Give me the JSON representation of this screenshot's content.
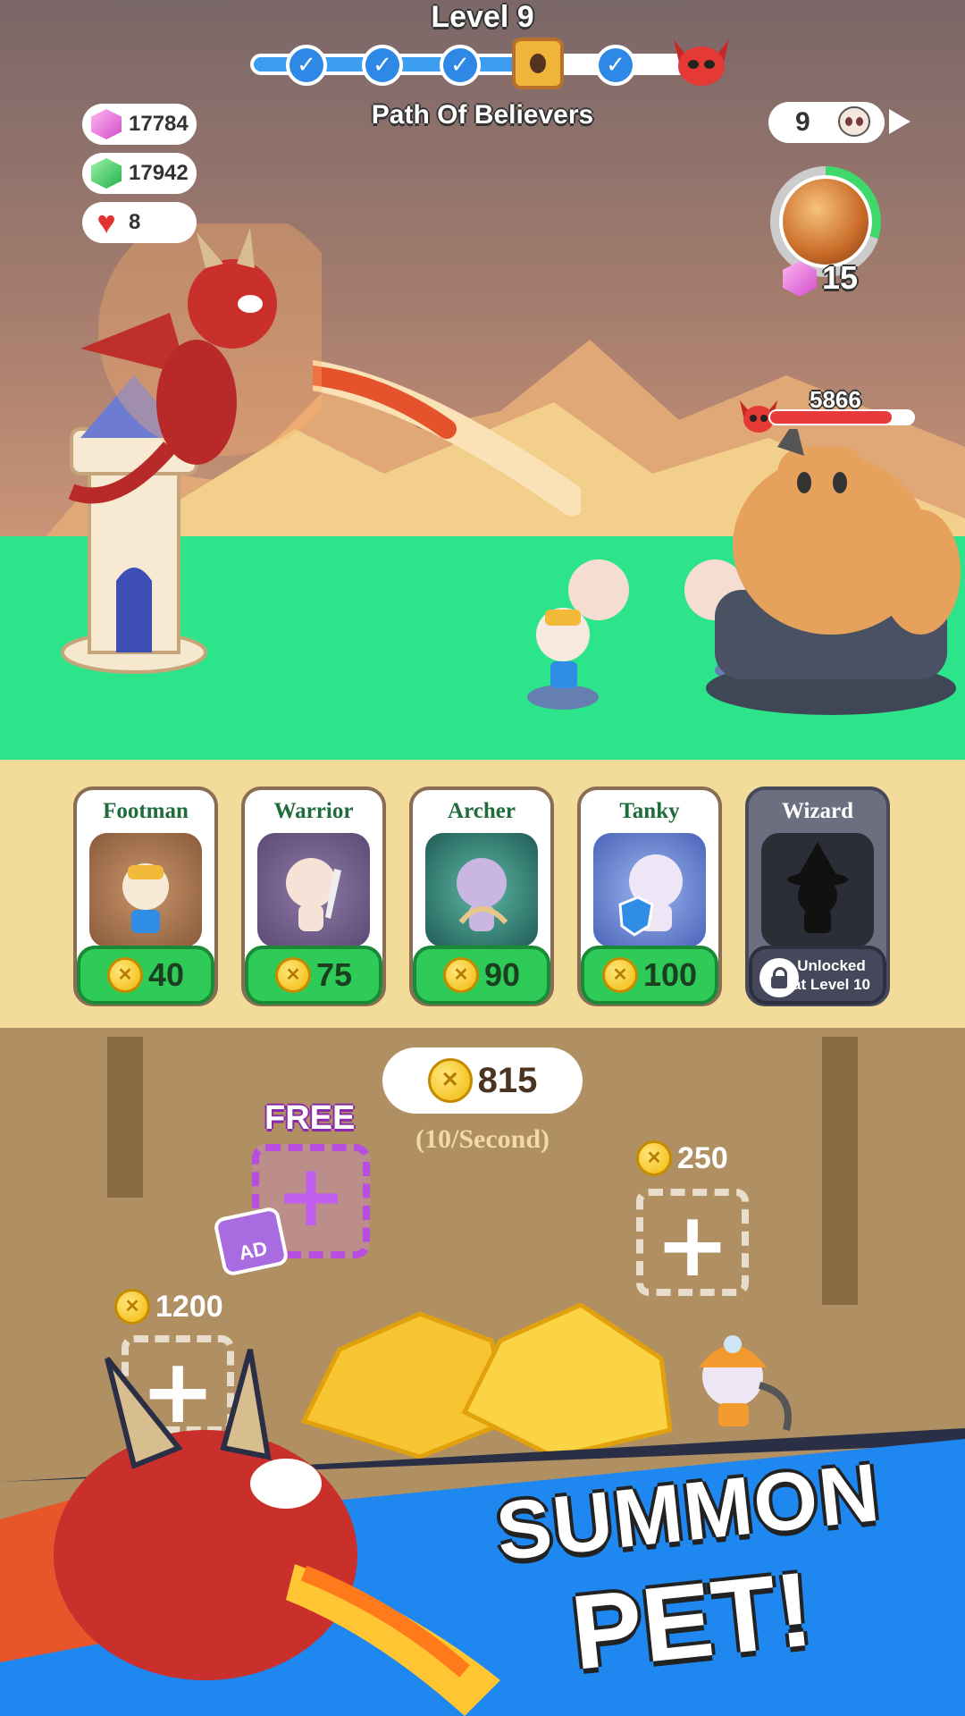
{
  "hud": {
    "level_title": "Level 9",
    "path_title": "Path Of Believers",
    "level_progress_stages_completed": 4,
    "level_progress_stages_total": 6,
    "gems_pink": "17784",
    "gems_green": "17942",
    "lives": "8",
    "wave": "9"
  },
  "ability": {
    "cost": "15",
    "cooldown_fraction": 0.3
  },
  "boss": {
    "hp": "5866",
    "hp_fraction": 0.85
  },
  "units": [
    {
      "name": "Footman",
      "cost": "40",
      "locked": false
    },
    {
      "name": "Warrior",
      "cost": "75",
      "locked": false
    },
    {
      "name": "Archer",
      "cost": "90",
      "locked": false
    },
    {
      "name": "Tanky",
      "cost": "100",
      "locked": false
    },
    {
      "name": "Wizard",
      "locked": true,
      "locked_line1": "Unlocked",
      "locked_line2": "at Level 10"
    }
  ],
  "mine": {
    "gold": "815",
    "rate": "(10/Second)",
    "free_label": "FREE",
    "ad_label": "AD",
    "slot_cost_right": "250",
    "slot_cost_left": "1200"
  },
  "banner": {
    "line1": "SUMMON",
    "line2": "PET!"
  },
  "colors": {
    "accent_blue": "#1e87f0",
    "buy_green": "#2fcb58",
    "free_purple": "#b84ee0",
    "grass": "#2ce58a"
  }
}
